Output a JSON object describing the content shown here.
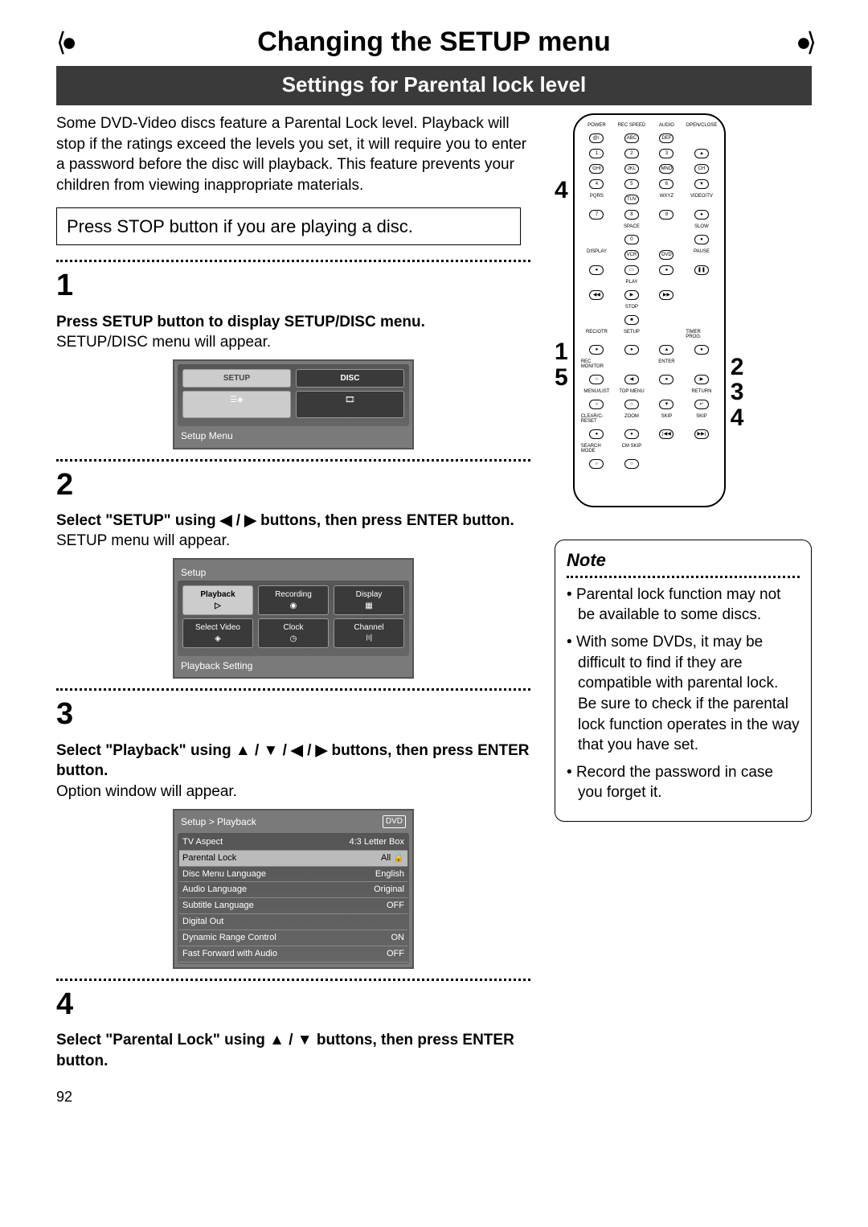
{
  "page": {
    "title": "Changing the SETUP menu",
    "subtitle": "Settings for Parental lock level",
    "page_number": "92"
  },
  "intro": "Some DVD-Video discs feature a Parental Lock level. Playback will stop if the ratings exceed the levels you set, it will require you to enter a password before the disc will playback. This feature prevents your children from viewing inappropriate materials.",
  "stop_hint": "Press STOP button if you are playing a disc.",
  "steps": {
    "s1": {
      "num": "1",
      "title": "Press SETUP button to display SETUP/DISC menu.",
      "body": "SETUP/DISC menu will appear."
    },
    "s2": {
      "num": "2",
      "title_a": "Select \"SETUP\" using ",
      "title_b": " buttons, then press ENTER button.",
      "arrows": "◀ / ▶",
      "body": "SETUP menu will appear."
    },
    "s3": {
      "num": "3",
      "title_a": "Select \"Playback\" using ",
      "title_b": " buttons, then press ENTER button.",
      "arrows": "▲ / ▼ / ◀ / ▶",
      "body": "Option window will appear."
    },
    "s4": {
      "num": "4",
      "title_a": "Select \"Parental Lock\" using ",
      "title_b": " buttons, then press ENTER button.",
      "arrows": "▲ / ▼"
    }
  },
  "screen1": {
    "cell_setup": "SETUP",
    "cell_disc": "DISC",
    "caption": "Setup Menu"
  },
  "screen2": {
    "header": "Setup",
    "cells": [
      "Playback",
      "Recording",
      "Display",
      "Select Video",
      "Clock",
      "Channel"
    ],
    "caption": "Playback Setting"
  },
  "screen3": {
    "header": "Setup > Playback",
    "badge": "DVD",
    "rows": [
      [
        "TV Aspect",
        "4:3 Letter Box"
      ],
      [
        "Parental Lock",
        "All  🔒"
      ],
      [
        "Disc Menu Language",
        "English"
      ],
      [
        "Audio Language",
        "Original"
      ],
      [
        "Subtitle Language",
        "OFF"
      ],
      [
        "Digital Out",
        ""
      ],
      [
        "Dynamic Range Control",
        "ON"
      ],
      [
        "Fast Forward with Audio",
        "OFF"
      ]
    ]
  },
  "remote": {
    "left_callouts": [
      "4",
      "1",
      "5"
    ],
    "right_callouts": [
      "2",
      "3",
      "4"
    ],
    "rows": [
      [
        "POWER",
        "REC SPEED",
        "AUDIO",
        "OPEN/CLOSE"
      ],
      [
        "@/.",
        "ABC",
        "DEF",
        ""
      ],
      [
        "1",
        "2",
        "3",
        "▲"
      ],
      [
        "GHI",
        "JKL",
        "MNO",
        "CH"
      ],
      [
        "4",
        "5",
        "6",
        "▼"
      ],
      [
        "PQRS",
        "TUV",
        "WXYZ",
        "VIDEO/TV"
      ],
      [
        "7",
        "8",
        "9",
        "●"
      ],
      [
        "",
        "SPACE",
        "",
        "SLOW"
      ],
      [
        "",
        "0",
        "",
        "●"
      ],
      [
        "DISPLAY",
        "VCR",
        "DVD",
        "PAUSE"
      ],
      [
        "●",
        "▭",
        "●",
        "❚❚"
      ],
      [
        "",
        "PLAY",
        "",
        ""
      ],
      [
        "◀◀",
        "▶",
        "▶▶",
        ""
      ],
      [
        "",
        "STOP",
        "",
        ""
      ],
      [
        "",
        "■",
        "",
        ""
      ],
      [
        "REC/OTR",
        "SETUP",
        "",
        "TIMER PROG."
      ],
      [
        "●",
        "●",
        "▲",
        "●"
      ],
      [
        "REC MONITOR",
        "",
        "ENTER",
        ""
      ],
      [
        "○",
        "◀",
        "●",
        "▶"
      ],
      [
        "MENU/LIST",
        "TOP MENU",
        "",
        "RETURN"
      ],
      [
        "○",
        "○",
        "▼",
        "↵"
      ],
      [
        "CLEAR/C-RESET",
        "ZOOM",
        "SKIP",
        "SKIP"
      ],
      [
        "●",
        "●",
        "|◀◀",
        "▶▶|"
      ],
      [
        "SEARCH MODE",
        "CM SKIP",
        "",
        ""
      ],
      [
        "○",
        "○",
        "",
        ""
      ]
    ]
  },
  "note": {
    "heading": "Note",
    "items": [
      "Parental lock function may not be available to some discs.",
      "With some DVDs, it may be difficult to find if they are compatible with parental lock. Be sure to check if the parental lock function operates in the way that you have set.",
      "Record the password in case you forget it."
    ]
  }
}
